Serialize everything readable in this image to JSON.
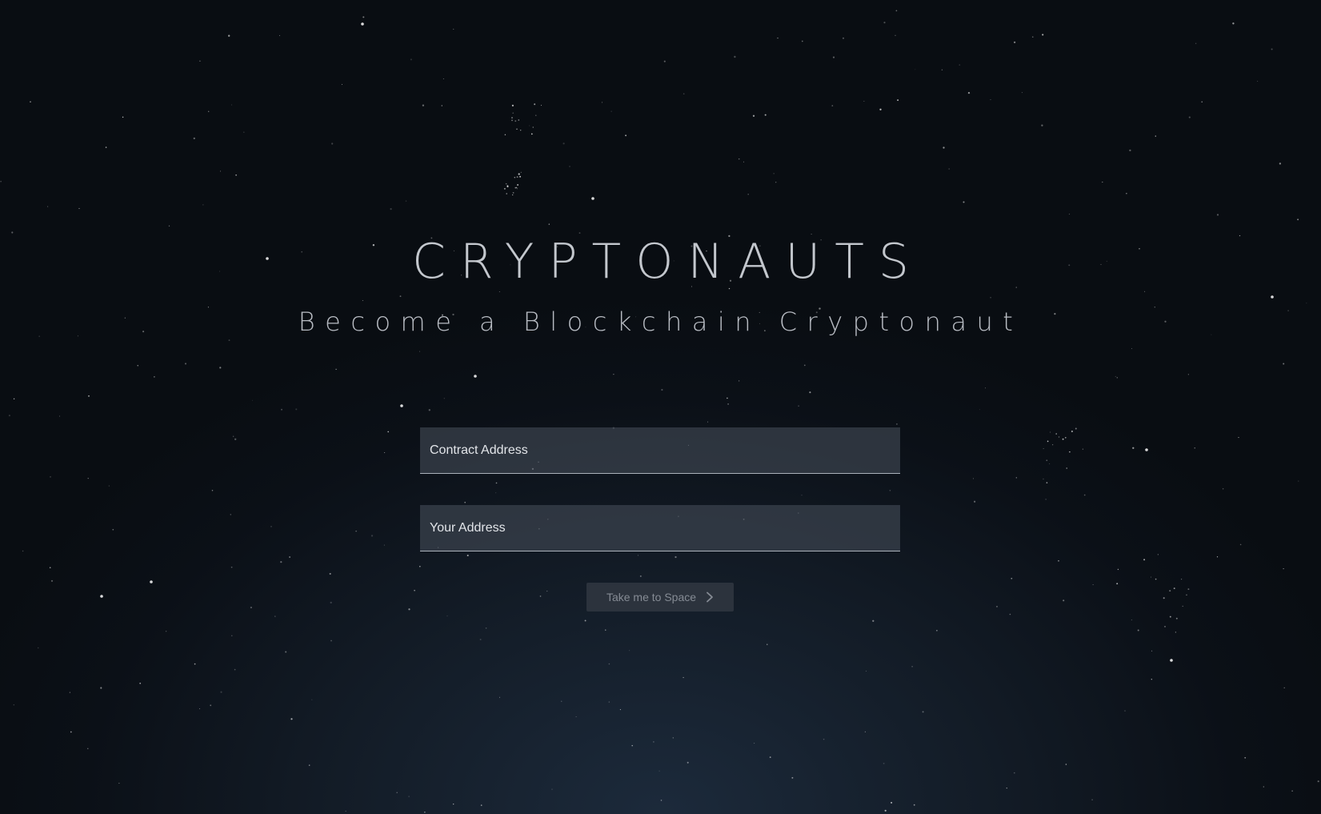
{
  "app": {
    "title": "CRYPTONAUTS",
    "tagline": "Become a Blockchain Cryptonaut"
  },
  "form": {
    "contract_address": {
      "placeholder": "Contract Address",
      "value": ""
    },
    "your_address": {
      "placeholder": "Your Address",
      "value": ""
    },
    "submit_label": "Take me to Space",
    "submit_icon": "chevron-right-icon"
  },
  "colors": {
    "background_dark": "#090d12",
    "background_glow": "#1c2a3b",
    "input_fill": "#424a56",
    "button_fill": "#2c333d",
    "button_text": "#858b94",
    "title_text": "#c3c7cd"
  }
}
